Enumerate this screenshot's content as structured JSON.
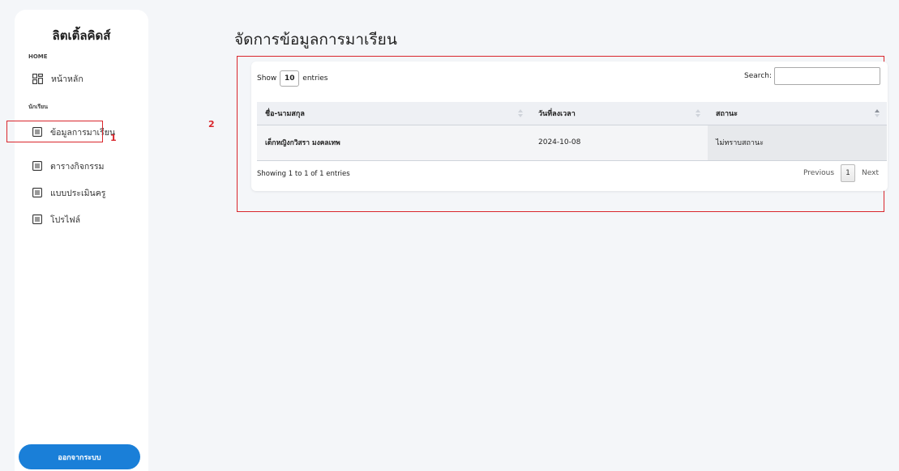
{
  "sidebar": {
    "brand": "ลิตเติ้ลคิดส์",
    "sections": [
      {
        "label": "HOME"
      },
      {
        "label": "นักเรียน"
      }
    ],
    "items": [
      {
        "label": "หน้าหลัก",
        "icon": "dashboard-icon"
      },
      {
        "label": "ข้อมูลการมาเรียน",
        "icon": "list-icon"
      },
      {
        "label": "ตารางกิจกรรม",
        "icon": "list-icon"
      },
      {
        "label": "แบบประเมินครู",
        "icon": "list-icon"
      },
      {
        "label": "โปรไฟล์",
        "icon": "list-icon"
      }
    ],
    "logout_label": "ออกจากระบบ"
  },
  "annotations": {
    "one": "1",
    "two": "2",
    "color": "#d9262c"
  },
  "main": {
    "title": "จัดการข้อมูลการมาเรียน",
    "show_label": "Show",
    "entries_value": "10",
    "entries_label": "entries",
    "search_label": "Search:",
    "search_value": "",
    "columns": [
      "ชื่อ-นามสกุล",
      "วันที่ลงเวลา",
      "สถานะ"
    ],
    "rows": [
      {
        "name": "เด็กหญิงกวิสรา มงคลเทพ",
        "date": "2024-10-08",
        "status": "ไม่ทราบสถานะ"
      }
    ],
    "info": "Showing 1 to 1 of 1 entries",
    "pager": {
      "prev": "Previous",
      "page": "1",
      "next": "Next"
    }
  },
  "colors": {
    "accent": "#1a7fd8",
    "background": "#f4f6f9",
    "annotation": "#d9262c"
  }
}
